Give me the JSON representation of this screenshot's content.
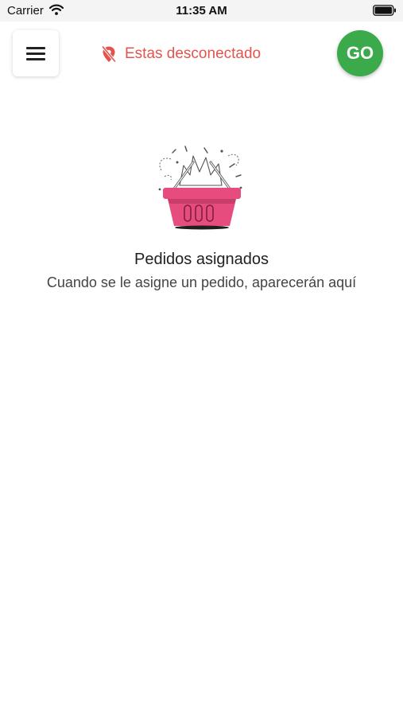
{
  "status_bar": {
    "carrier": "Carrier",
    "time": "11:35 AM",
    "wifi_icon": "wifi-icon",
    "battery_icon": "battery-icon"
  },
  "header": {
    "menu_icon": "hamburger-menu-icon",
    "status_icon": "location-off-icon",
    "status_text": "Estas desconectado",
    "go_label": "GO"
  },
  "empty_state": {
    "illustration": "shopping-basket-illustration",
    "title": "Pedidos asignados",
    "description": "Cuando se le asigne un pedido, aparecerán aquí"
  },
  "colors": {
    "status_text": "#e2544d",
    "go_button": "#3aaa4a",
    "basket": "#e64c7d"
  }
}
